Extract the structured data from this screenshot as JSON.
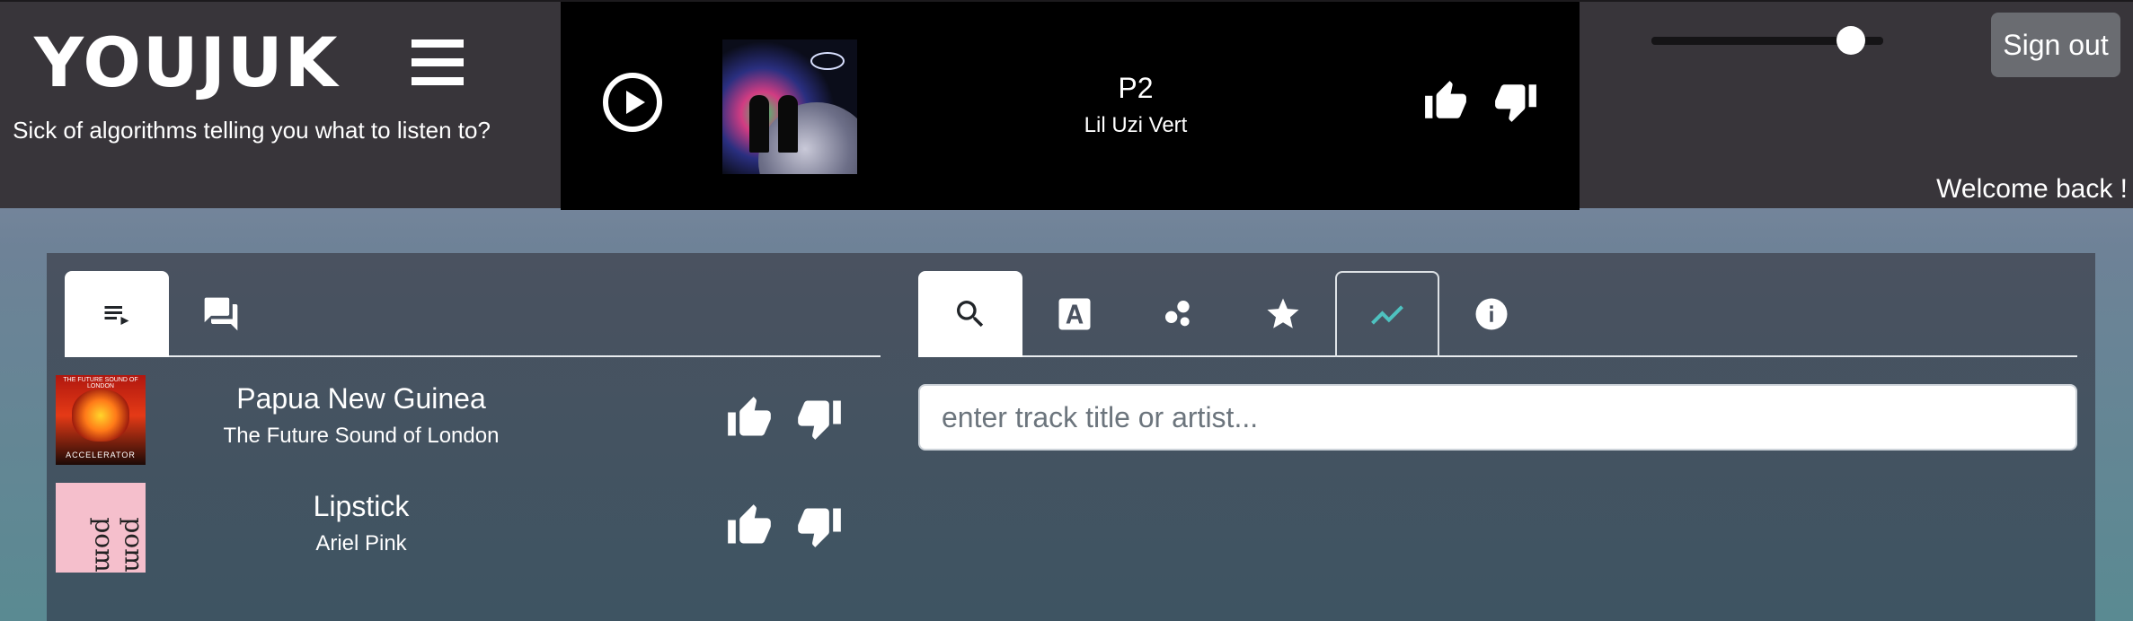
{
  "header": {
    "logo_text": "YOUJUKE",
    "logo_display": "YOUJUK",
    "tagline": "Sick of algorithms telling you what to listen to?",
    "welcome": "Welcome back !",
    "signout_label": "Sign out"
  },
  "now_playing": {
    "title": "P2",
    "artist": "Lil Uzi Vert",
    "state": "paused",
    "icons": {
      "play": "play-circle-icon",
      "like": "thumbs-up-icon",
      "dislike": "thumbs-down-icon"
    }
  },
  "volume": {
    "level": 0.86
  },
  "left_tabs": [
    {
      "icon": "queue-icon",
      "active": true
    },
    {
      "icon": "chat-icon",
      "active": false
    }
  ],
  "queue": [
    {
      "title": "Papua New Guinea",
      "artist": "The Future Sound of London",
      "cover_text_top": "THE FUTURE SOUND OF LONDON",
      "cover_text_bottom": "ACCELERATOR"
    },
    {
      "title": "Lipstick",
      "artist": "Ariel Pink",
      "cover_text": "pom pom"
    }
  ],
  "right_tabs": [
    {
      "icon": "search-icon",
      "active": true
    },
    {
      "icon": "artist-icon",
      "active": false
    },
    {
      "icon": "bubbles-icon",
      "active": false
    },
    {
      "icon": "star-icon",
      "active": false
    },
    {
      "icon": "trending-icon",
      "active": false,
      "outlined": true
    },
    {
      "icon": "info-icon",
      "active": false
    }
  ],
  "search": {
    "placeholder": "enter track title or artist...",
    "value": ""
  },
  "colors": {
    "header_bg": "#38353a",
    "player_bg": "#000000",
    "accent_trending": "#4ec2c0",
    "signout_bg": "#6a6c71"
  }
}
